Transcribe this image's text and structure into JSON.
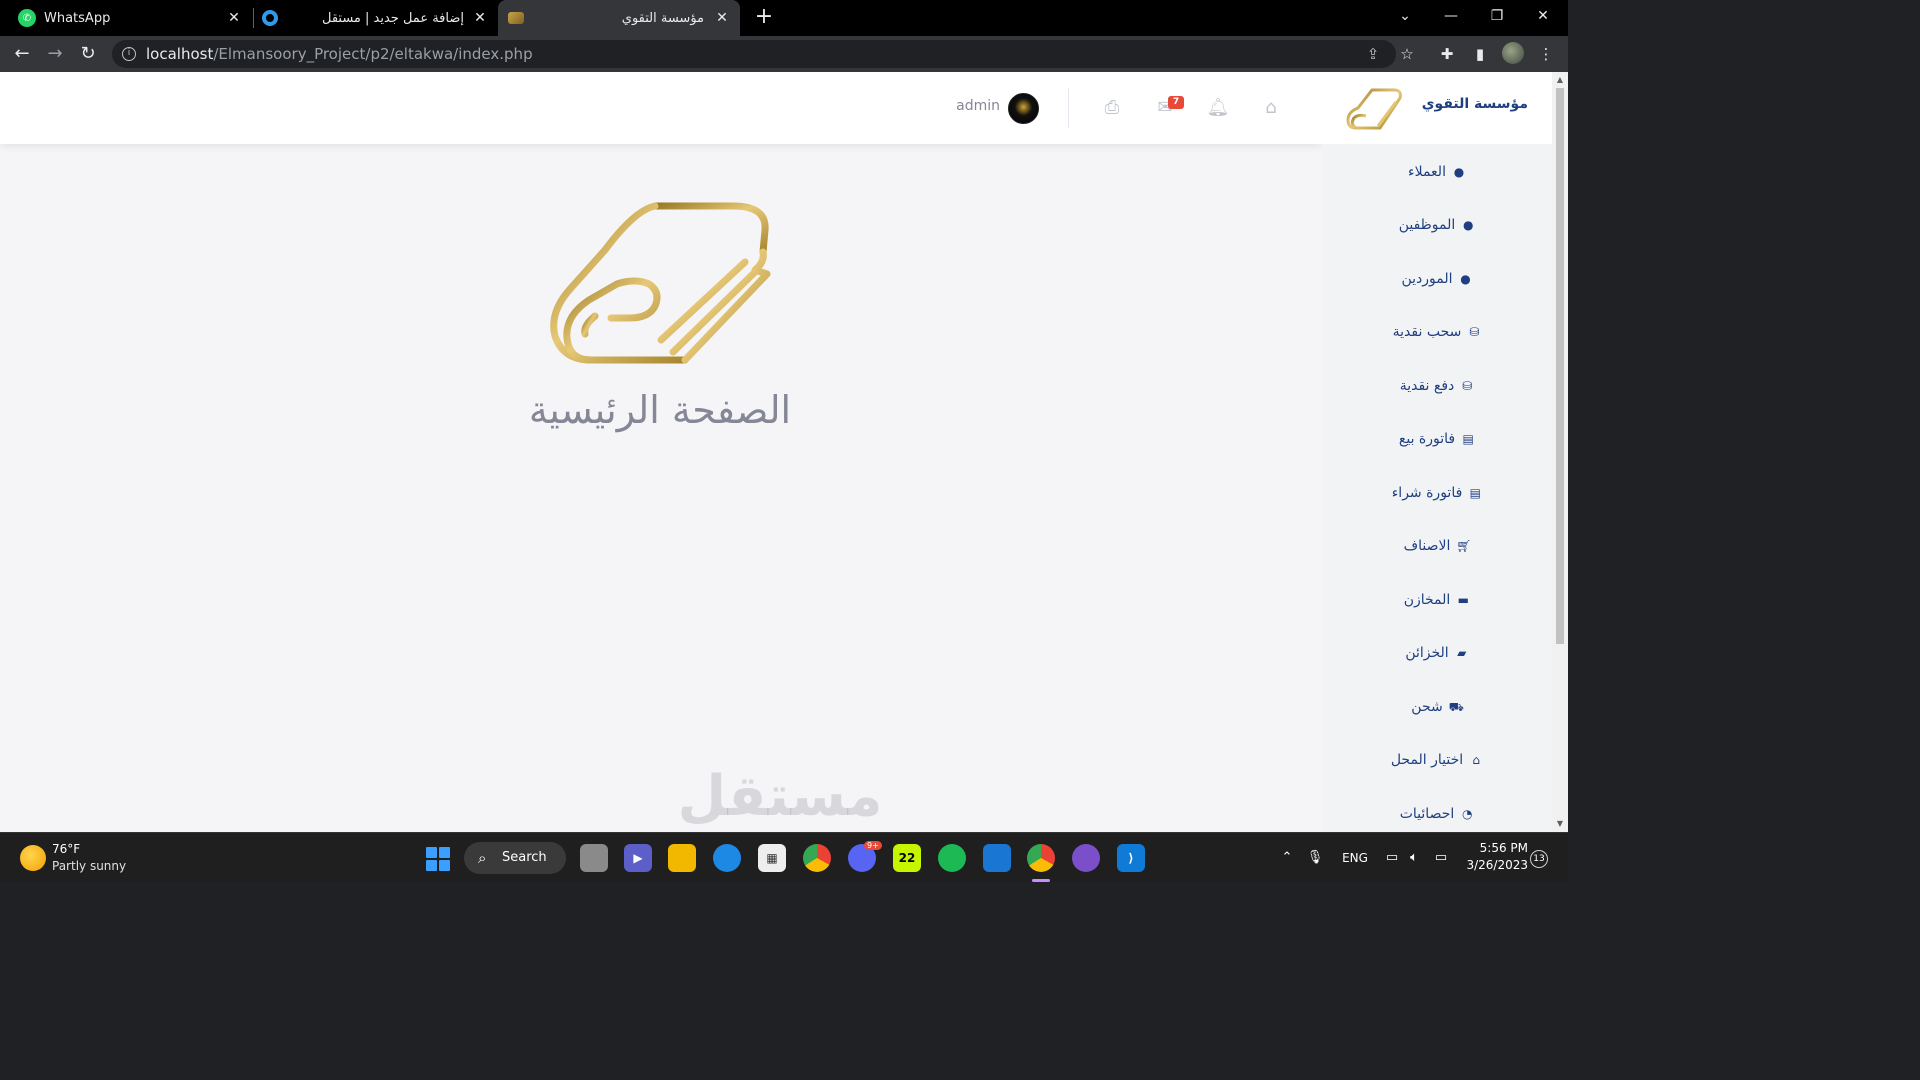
{
  "browser": {
    "tabs": [
      {
        "title": "WhatsApp",
        "icon": "whatsapp-icon"
      },
      {
        "title": "إضافة عمل جديد | مستقل",
        "icon": "mostaql-icon"
      },
      {
        "title": "مؤسسة التقوي",
        "icon": "site-logo-icon",
        "active": true
      }
    ],
    "url_host": "localhost",
    "url_path": "/Elmansoory_Project/p2/eltakwa/index.php"
  },
  "topbar": {
    "notification_count": "7",
    "username": "admin"
  },
  "sidebar": {
    "brand": "مؤسسة التقوي",
    "items": [
      {
        "label": "العملاء",
        "icon": "user-icon"
      },
      {
        "label": "الموظفين",
        "icon": "user-icon"
      },
      {
        "label": "الموردين",
        "icon": "user-icon"
      },
      {
        "label": "سحب نقدية",
        "icon": "coins-icon"
      },
      {
        "label": "دفع نقدية",
        "icon": "coins-icon"
      },
      {
        "label": "فاتورة بيع",
        "icon": "invoice-icon"
      },
      {
        "label": "فاتورة شراء",
        "icon": "invoice-icon"
      },
      {
        "label": "الاصناف",
        "icon": "cart-icon"
      },
      {
        "label": "المخازن",
        "icon": "store-icon"
      },
      {
        "label": "الخزائن",
        "icon": "wallet-icon"
      },
      {
        "label": "شحن",
        "icon": "shipping-icon"
      },
      {
        "label": "اختيار المحل",
        "icon": "bank-icon"
      },
      {
        "label": "احصائيات",
        "icon": "gauge-icon"
      }
    ]
  },
  "main": {
    "title": "الصفحة الرئيسية"
  },
  "watermark": "مستقل",
  "taskbar": {
    "weather_temp": "76°F",
    "weather_desc": "Partly sunny",
    "search_label": "Search",
    "apps": [
      "task-view-icon",
      "meet-icon",
      "file-explorer-icon",
      "edge-icon",
      "store-icon",
      "chrome-icon",
      "discord-icon",
      "app-22-icon",
      "spotify-icon",
      "app-blue-icon",
      "chrome-active-icon",
      "github-desktop-icon",
      "vscode-icon"
    ],
    "app_22_label": "22",
    "discord_badge": "9+",
    "language": "ENG",
    "time": "5:56 PM",
    "date": "3/26/2023",
    "notification_count": "13"
  },
  "colors": {
    "sidebar_text": "#1f3f80",
    "gold": "#c9a44a",
    "badge": "#e74a3b"
  }
}
